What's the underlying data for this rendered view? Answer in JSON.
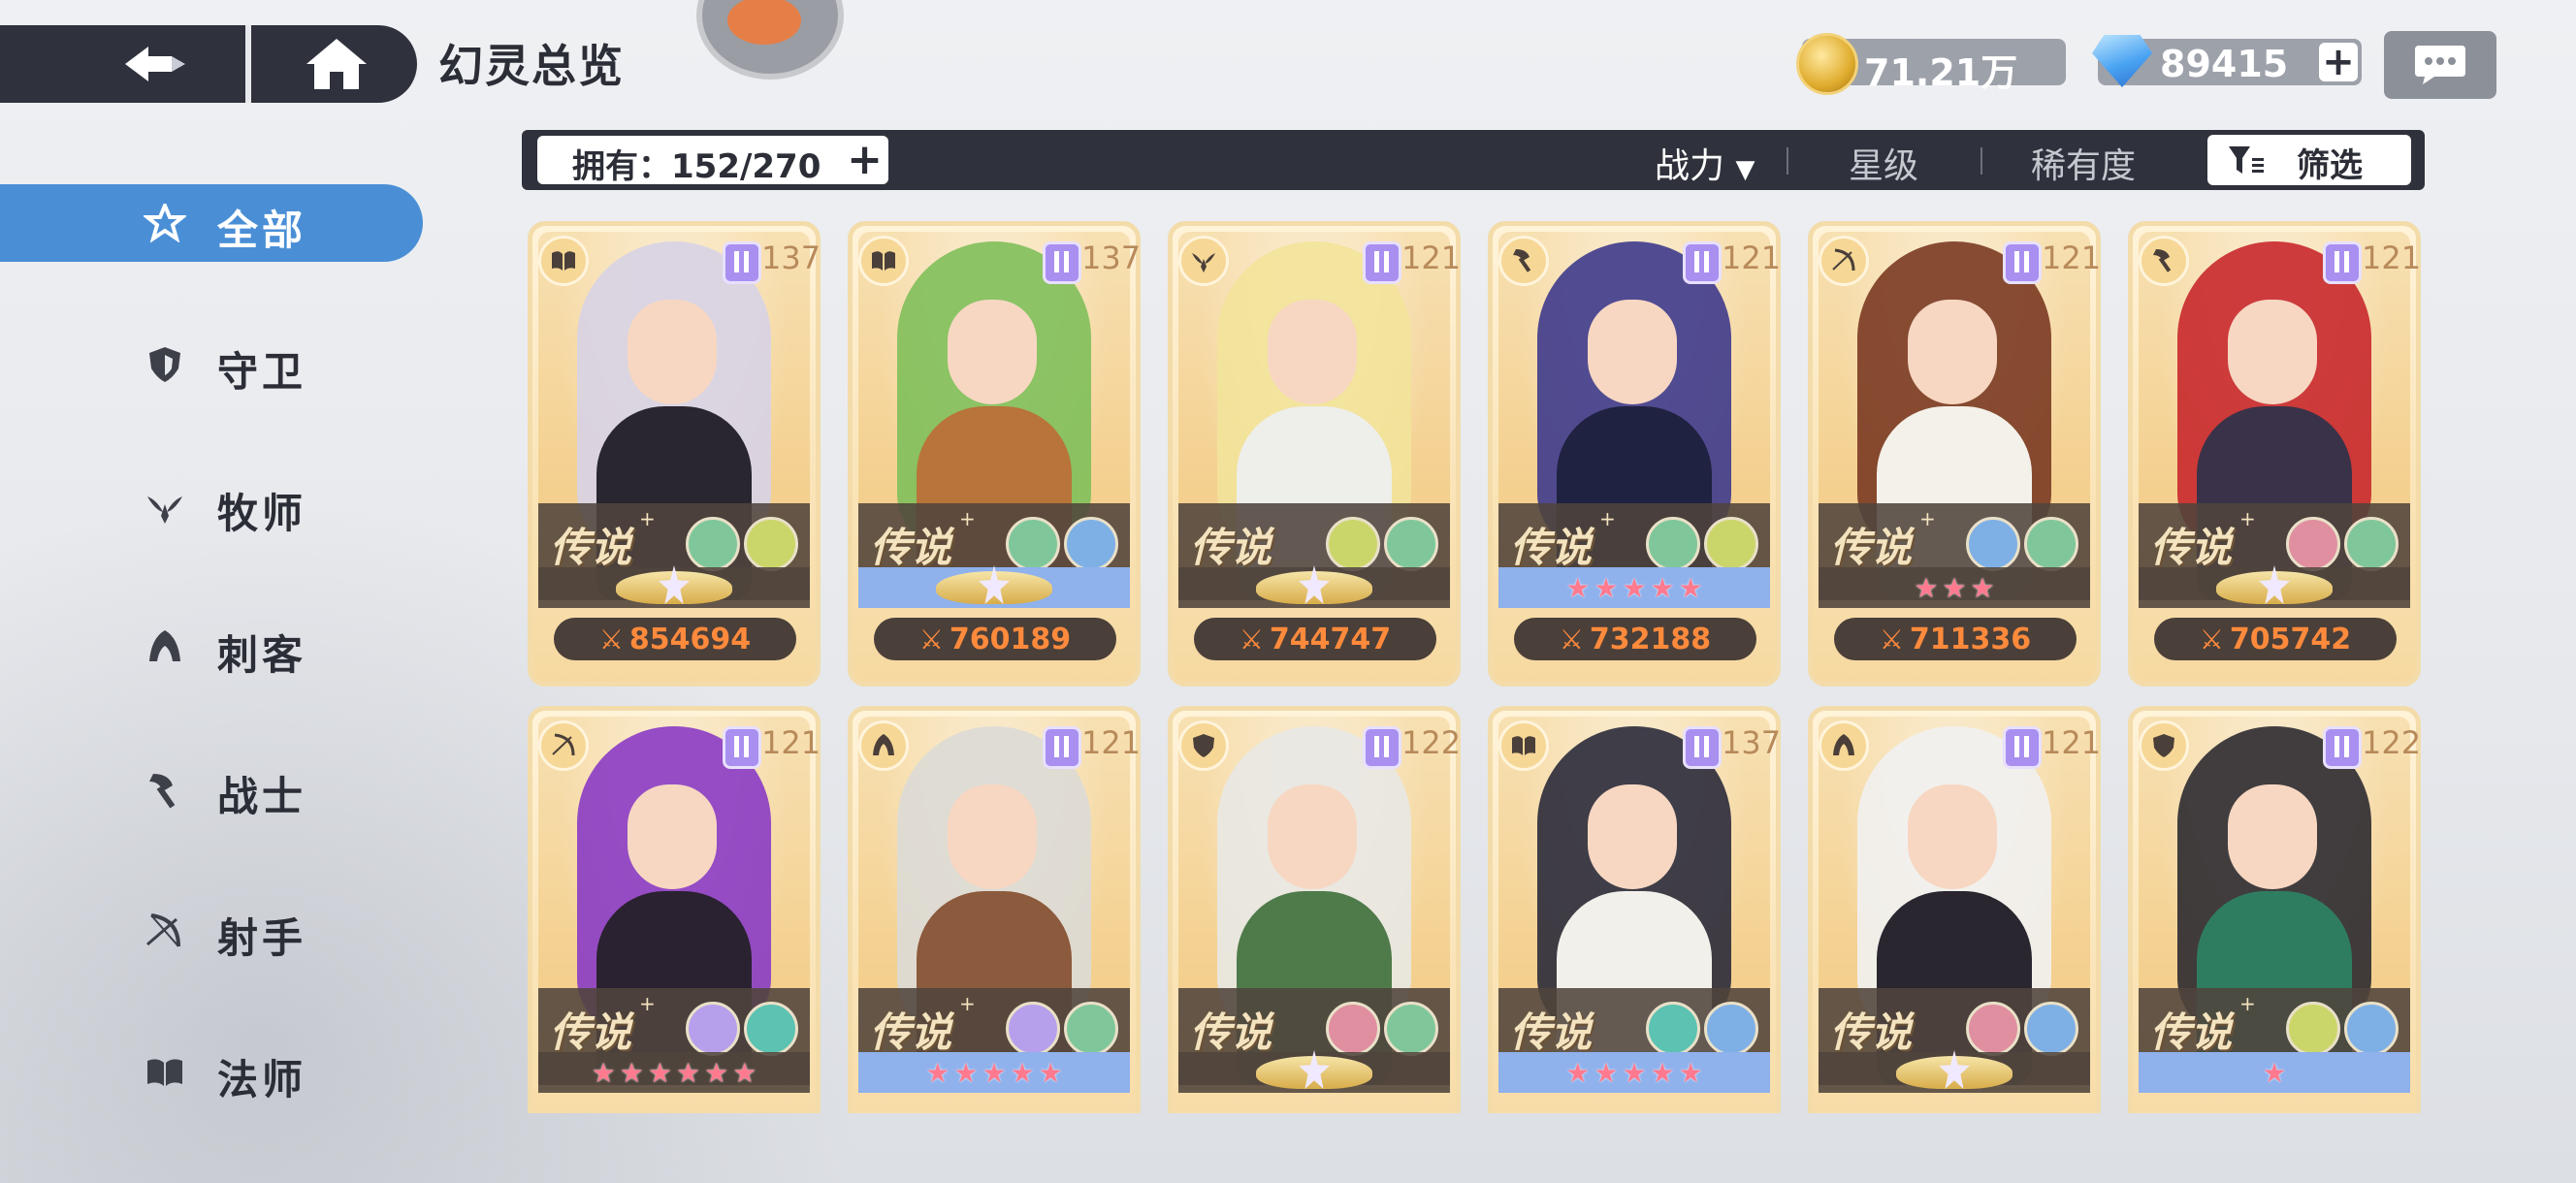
{
  "header": {
    "title": "幻灵总览"
  },
  "currency": {
    "gold": "71.21万",
    "gems": "89415",
    "plus": "+"
  },
  "sidebar": {
    "items": [
      {
        "label": "全部",
        "icon": "star-hex-icon"
      },
      {
        "label": "守卫",
        "icon": "shield-icon"
      },
      {
        "label": "牧师",
        "icon": "wing-icon"
      },
      {
        "label": "刺客",
        "icon": "hood-icon"
      },
      {
        "label": "战士",
        "icon": "axe-icon"
      },
      {
        "label": "射手",
        "icon": "bow-icon"
      },
      {
        "label": "法师",
        "icon": "book-icon"
      }
    ]
  },
  "filterbar": {
    "owned": "拥有：152/270",
    "sort_power": "战力",
    "sort_power_arrow": "▼",
    "sort_star": "星级",
    "sort_rarity": "稀有度",
    "filter": "筛选"
  },
  "colors": {
    "accent": "#4a8fd6",
    "dark": "#2f323c",
    "power": "#ff8a3c",
    "star": "#ff7a8f"
  },
  "cards": [
    {
      "rarity": "传说",
      "sup": "+",
      "level": "137",
      "role": "book-icon",
      "power": "854694",
      "stars": "crest",
      "row": "dark",
      "hair": "#d7d3e6",
      "body": "#2a2630",
      "e1": "#7fc79a",
      "e2": "#cbd66a"
    },
    {
      "rarity": "传说",
      "sup": "+",
      "level": "137",
      "role": "book-icon",
      "power": "760189",
      "stars": "crest",
      "row": "blue",
      "hair": "#7fbf5a",
      "body": "#b9743a",
      "e1": "#7fc79a",
      "e2": "#7eb0e6"
    },
    {
      "rarity": "传说",
      "sup": "",
      "level": "121",
      "role": "wing-icon",
      "power": "744747",
      "stars": "crest",
      "row": "dark",
      "hair": "#f2e39a",
      "body": "#eeeeea",
      "e1": "#cbd66a",
      "e2": "#7fc79a"
    },
    {
      "rarity": "传说",
      "sup": "+",
      "level": "121",
      "role": "axe-icon",
      "power": "732188",
      "stars": "5",
      "row": "blue",
      "hair": "#3e3a8c",
      "body": "#1f2240",
      "e1": "#7fc79a",
      "e2": "#cbd66a"
    },
    {
      "rarity": "传说",
      "sup": "+",
      "level": "121",
      "role": "bow-icon",
      "power": "711336",
      "stars": "3",
      "row": "dark",
      "hair": "#7a3a22",
      "body": "#f4f1ea",
      "e1": "#7eb0e6",
      "e2": "#7fc79a"
    },
    {
      "rarity": "传说",
      "sup": "+",
      "level": "121",
      "role": "axe-icon",
      "power": "705742",
      "stars": "crest",
      "row": "dark",
      "hair": "#c8282c",
      "body": "#3a3248",
      "e1": "#e08fa0",
      "e2": "#7fc79a"
    },
    {
      "rarity": "传说",
      "sup": "+",
      "level": "121",
      "role": "bow-icon",
      "power": "",
      "stars": "6",
      "row": "dark",
      "hair": "#8a3bc4",
      "body": "#2a2230",
      "e1": "#b6a0ec",
      "e2": "#5cc2b2"
    },
    {
      "rarity": "传说",
      "sup": "+",
      "level": "121",
      "role": "hood-icon",
      "power": "",
      "stars": "5",
      "row": "blue",
      "hair": "#dcdad6",
      "body": "#8c5a3c",
      "e1": "#b6a0ec",
      "e2": "#7fc79a"
    },
    {
      "rarity": "传说",
      "sup": "",
      "level": "122",
      "role": "shield-icon",
      "power": "",
      "stars": "crest",
      "row": "dark",
      "hair": "#e8e8e4",
      "body": "#4f7a4a",
      "e1": "#e08fa0",
      "e2": "#7fc79a"
    },
    {
      "rarity": "传说",
      "sup": "",
      "level": "137",
      "role": "book-icon",
      "power": "",
      "stars": "5",
      "row": "blue",
      "hair": "#2a2a3a",
      "body": "#f2f0ea",
      "e1": "#5cc2b2",
      "e2": "#7eb0e6"
    },
    {
      "rarity": "传说",
      "sup": "",
      "level": "121",
      "role": "hood-icon",
      "power": "",
      "stars": "crest",
      "row": "dark",
      "hair": "#f1f1f1",
      "body": "#2a2630",
      "e1": "#e08fa0",
      "e2": "#7eb0e6"
    },
    {
      "rarity": "传说",
      "sup": "+",
      "level": "122",
      "role": "shield-icon",
      "power": "",
      "stars": "1",
      "row": "blue",
      "hair": "#2c2a30",
      "body": "#2f7d60",
      "e1": "#cbd66a",
      "e2": "#7eb0e6"
    }
  ]
}
